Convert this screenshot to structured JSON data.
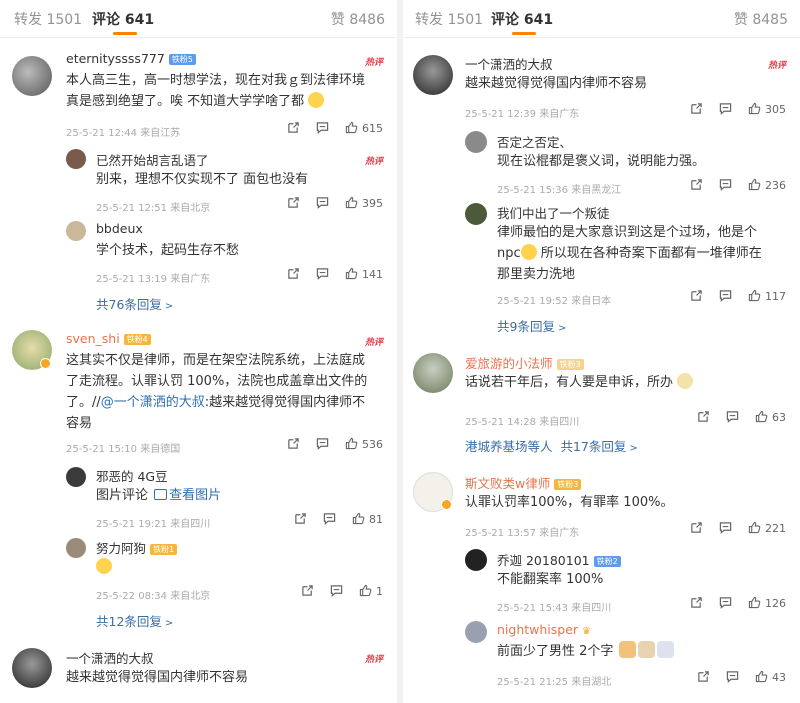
{
  "left": {
    "tabs": {
      "repost": "转发 1501",
      "comments": "评论 641",
      "likes": "赞 8486"
    },
    "comments": [
      {
        "user": "eternityssss777",
        "level": "铁粉5",
        "hot": "热评",
        "text1": "本人高三生，高一时想学法，现在对我ｇ到法律环境",
        "text2": "真是感到绝望了。唉 不知道大学学啥了都",
        "meta": "25-5-21 12:44  来自江苏",
        "likes": "615"
      },
      {
        "user": "已然开始胡言乱语了",
        "hot": "热评",
        "text": "别来，理想不仅实现不了 面包也没有",
        "meta": "25-5-21 12:51  来自北京",
        "likes": "395"
      },
      {
        "user": "bbdeux",
        "text": "学个技术，起码生存不愁",
        "meta": "25-5-21 13:19  来自广东",
        "likes": "141"
      },
      {
        "more": "共76条回复"
      },
      {
        "user": "sven_shi",
        "level": "铁粉4",
        "hot": "热评",
        "text1": "这其实不仅是律师，而是在架空法院系统，上法庭成",
        "text2": "了走流程。认罪认罚 100%，法院也成盖章出文件的",
        "text3a": "了。//",
        "mention": "@一个潇洒的大叔",
        "text3b": ":越来越觉得觉得国内律师不",
        "text4": "容易",
        "meta": "25-5-21 15:10  来自德国",
        "likes": "536"
      },
      {
        "user": "邪恶的 4G豆",
        "text_a": "图片评论 ",
        "text_b": "查看图片",
        "meta": "25-5-21 19:21  来自四川",
        "likes": "81"
      },
      {
        "user": "努力阿狗",
        "level": "铁粉1",
        "meta": "25-5-22 08:34  来自北京",
        "likes": "1"
      },
      {
        "more": "共12条回复"
      },
      {
        "user": "一个潇洒的大叔",
        "hot": "热评",
        "text": "越来越觉得觉得国内律师不容易"
      }
    ]
  },
  "right": {
    "tabs": {
      "repost": "转发 1501",
      "comments": "评论 641",
      "likes": "赞 8485"
    },
    "comments": [
      {
        "user": "一个潇洒的大叔",
        "hot": "热评",
        "text": "越来越觉得觉得国内律师不容易",
        "meta": "25-5-21 12:39  来自广东",
        "likes": "305"
      },
      {
        "user": "否定之否定、",
        "text": "现在讼棍都是褒义词，说明能力强。",
        "meta": "25-5-21 15:36  来自黑龙江",
        "likes": "236"
      },
      {
        "user": "我们中出了一个叛徒",
        "text1": "律师最怕的是大家意识到这是个过场，他是个",
        "text2a": "npc",
        "text2b": " 所以现在各种奇案下面都有一堆律师在",
        "text3": "那里卖力洗地",
        "meta": "25-5-21 19:52  来自日本",
        "likes": "117"
      },
      {
        "more": "共9条回复"
      },
      {
        "user": "爱旅游的小法师",
        "level": "铁粉3",
        "text": "话说若干年后，有人要是申诉，所办",
        "meta": "25-5-21 14:28  来自四川",
        "likes": "63"
      },
      {
        "more_a": "港城养基场等人",
        "more_b": "共17条回复"
      },
      {
        "user": "斯文败类w律师",
        "level": "铁粉3",
        "text": "认罪认罚率100%，有罪率 100%。",
        "meta": "25-5-21 13:57  来自广东",
        "likes": "221"
      },
      {
        "user": "乔迦 20180101",
        "level": "铁粉2",
        "text": "不能翻案率 100%",
        "meta": "25-5-21 15:43  来自四川",
        "likes": "126"
      },
      {
        "user": "nightwhisper",
        "text": "前面少了男性 2个字",
        "meta": "25-5-21 21:25  来自湖北",
        "likes": "43"
      }
    ]
  },
  "colors": {
    "accent": "#ff8200",
    "link": "#3a6ea5",
    "hot": "#e0414b",
    "name_orange": "#eb7350"
  },
  "icons": [
    "share-icon",
    "comment-icon",
    "like-icon",
    "chevron-right-icon",
    "image-icon"
  ]
}
